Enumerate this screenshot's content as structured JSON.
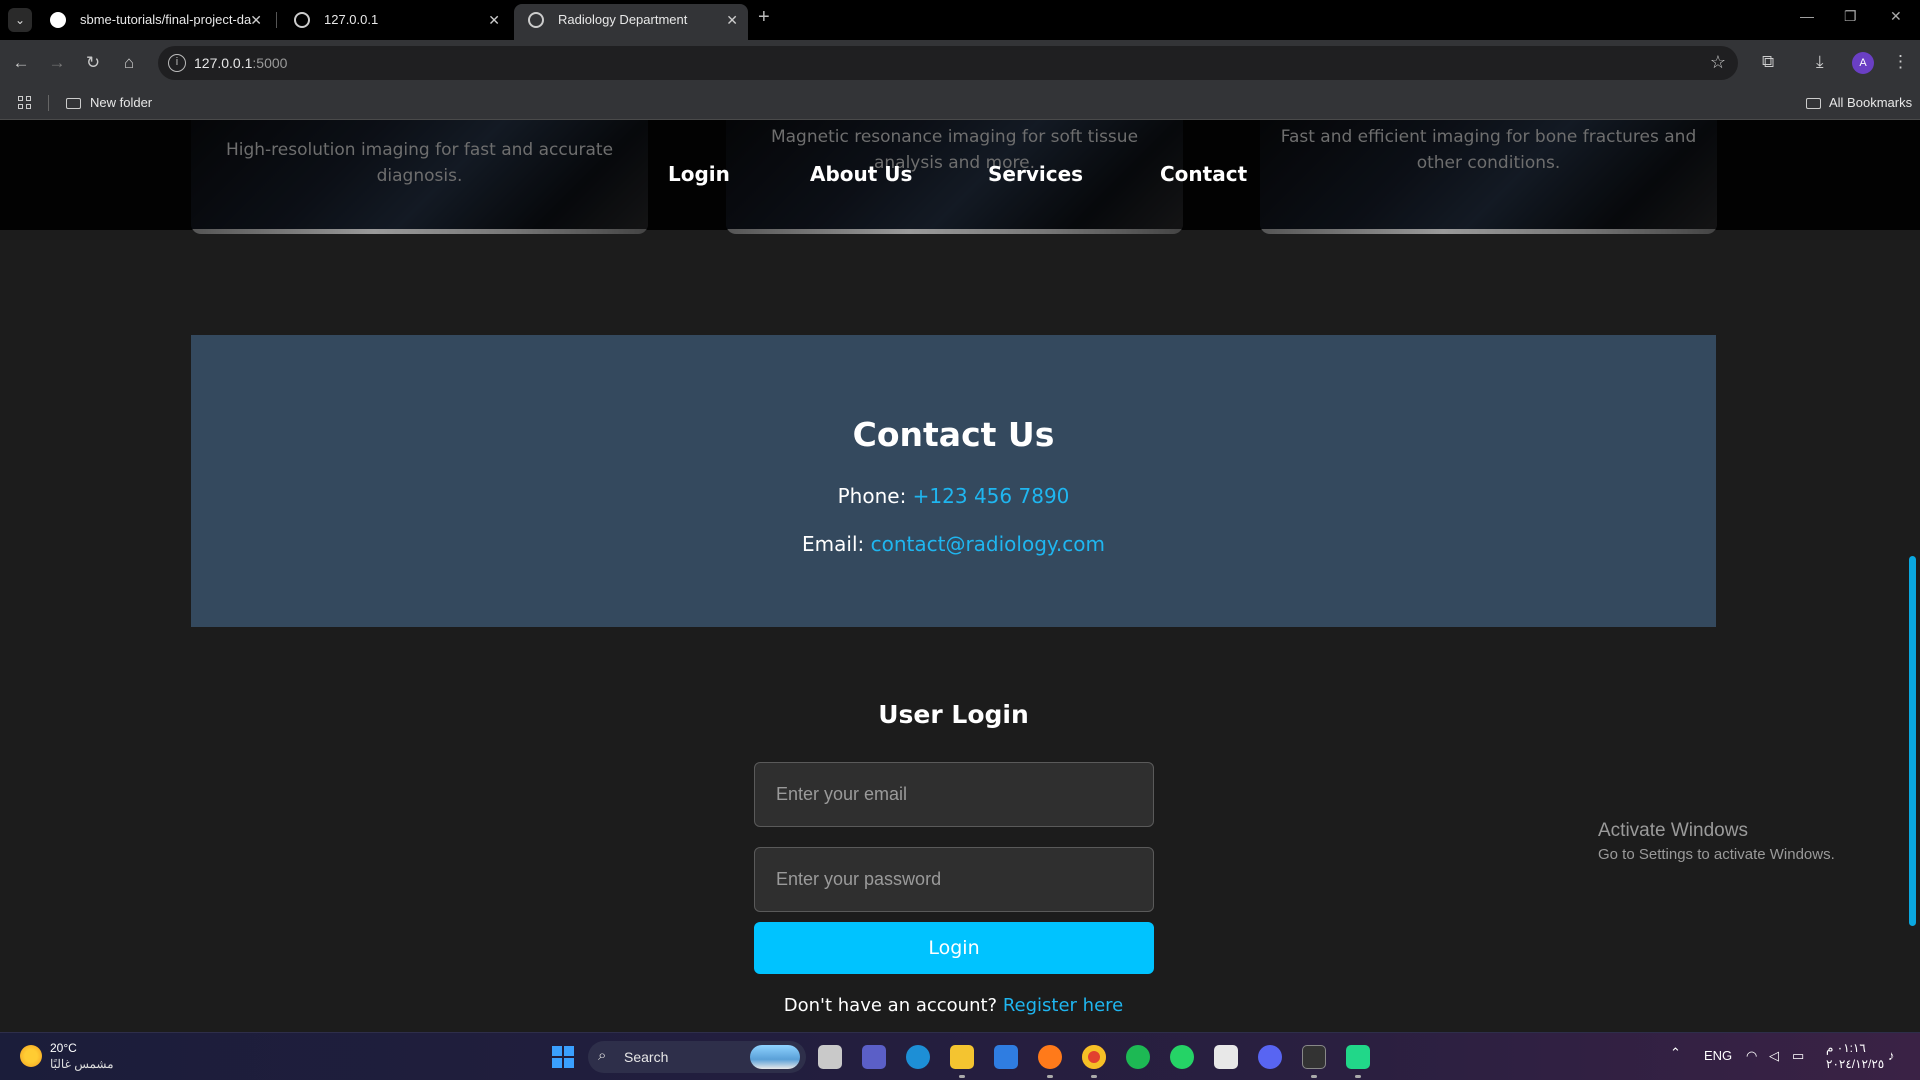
{
  "browser": {
    "tabs": [
      {
        "title": "sbme-tutorials/final-project-da",
        "icon": "github-icon",
        "active": false
      },
      {
        "title": "127.0.0.1",
        "icon": "globe-icon",
        "active": false
      },
      {
        "title": "Radiology Department",
        "icon": "globe-icon",
        "active": true
      }
    ],
    "new_tab": "+",
    "url_host": "127.0.0.1",
    "url_port": ":5000",
    "bookmarks": {
      "folder": "New folder",
      "all": "All Bookmarks"
    },
    "profile_initial": "A"
  },
  "page": {
    "services": [
      {
        "text": "High-resolution imaging for fast and accurate diagnosis."
      },
      {
        "text": "Magnetic resonance imaging for soft tissue analysis and more."
      },
      {
        "text": "Fast and efficient imaging for bone fractures and other conditions."
      }
    ],
    "nav": {
      "login": "Login",
      "about": "About Us",
      "services": "Services",
      "contact": "Contact"
    },
    "contact": {
      "title": "Contact Us",
      "phone_label": "Phone:",
      "phone_value": "+123 456 7890",
      "email_label": "Email:",
      "email_value": "contact@radiology.com"
    },
    "login": {
      "title": "User Login",
      "email_placeholder": "Enter your email",
      "password_placeholder": "Enter your password",
      "button": "Login",
      "no_account": "Don't have an account?",
      "register": "Register here"
    }
  },
  "watermark": {
    "line1": "Activate Windows",
    "line2": "Go to Settings to activate Windows."
  },
  "taskbar": {
    "weather_temp": "20°C",
    "weather_desc": "مشمس غالبًا",
    "search": "Search",
    "lang": "ENG",
    "time": "٠١:١٦ م",
    "date": "٢٠٢٤/١٢/٢٥"
  },
  "colors": {
    "accent": "#00c3ff",
    "link": "#1fb6f0",
    "contact_bg": "#34495e",
    "page_bg": "#1c1c1c"
  }
}
